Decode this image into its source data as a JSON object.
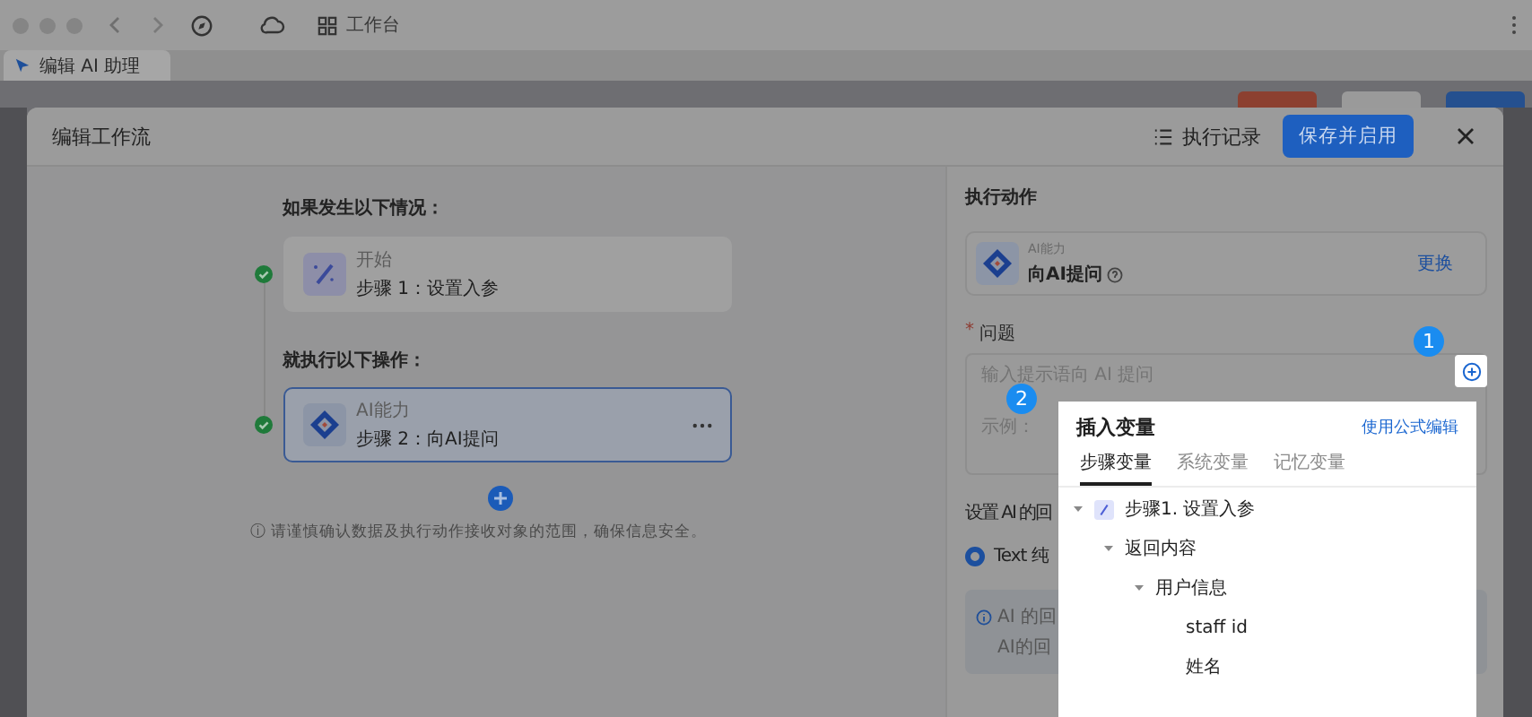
{
  "browser": {
    "address": "工作台",
    "tab_title": "编辑 AI 助理"
  },
  "dialog": {
    "title": "编辑工作流",
    "history_button": "执行记录",
    "save_button": "保存并启用"
  },
  "flow": {
    "trigger_heading": "如果发生以下情况：",
    "trigger": {
      "kind": "start",
      "label": "开始",
      "step": "步骤 1：设置入参",
      "done": true,
      "selected": false
    },
    "action_heading": "就执行以下操作：",
    "actions": [
      {
        "kind": "ai",
        "label": "AI能力",
        "step": "步骤 2：向AI提问",
        "done": true,
        "selected": true
      }
    ],
    "notice": "ⓘ 请谨慎确认数据及执行动作接收对象的范围，确保信息安全。"
  },
  "action_panel": {
    "heading": "执行动作",
    "ability": {
      "category": "AI能力",
      "name": "向AI提问",
      "change": "更换"
    },
    "question": {
      "label": "问题",
      "required_mark": "*",
      "placeholder": "输入提示语向 AI 提问",
      "example": "示例："
    },
    "reply_heading": "设置 AI 的回",
    "format": {
      "label": "Text 纯",
      "selected": true
    },
    "info": [
      "AI 的回",
      "AI的回"
    ]
  },
  "guide_badges": [
    "1",
    "2"
  ],
  "variable_popup": {
    "title": "插入变量",
    "formula_link": "使用公式编辑",
    "tabs": [
      {
        "label": "步骤变量",
        "selected": true
      },
      {
        "label": "系统变量",
        "selected": false
      },
      {
        "label": "记忆变量",
        "selected": false
      }
    ],
    "tree": [
      {
        "label": "步骤1. 设置入参",
        "icon": true,
        "expanded": true,
        "children": [
          {
            "label": "返回内容",
            "expanded": true,
            "children": [
              {
                "label": "用户信息",
                "expanded": true,
                "children": [
                  {
                    "label": "staff id"
                  },
                  {
                    "label": "姓名"
                  }
                ]
              }
            ]
          }
        ]
      }
    ]
  }
}
